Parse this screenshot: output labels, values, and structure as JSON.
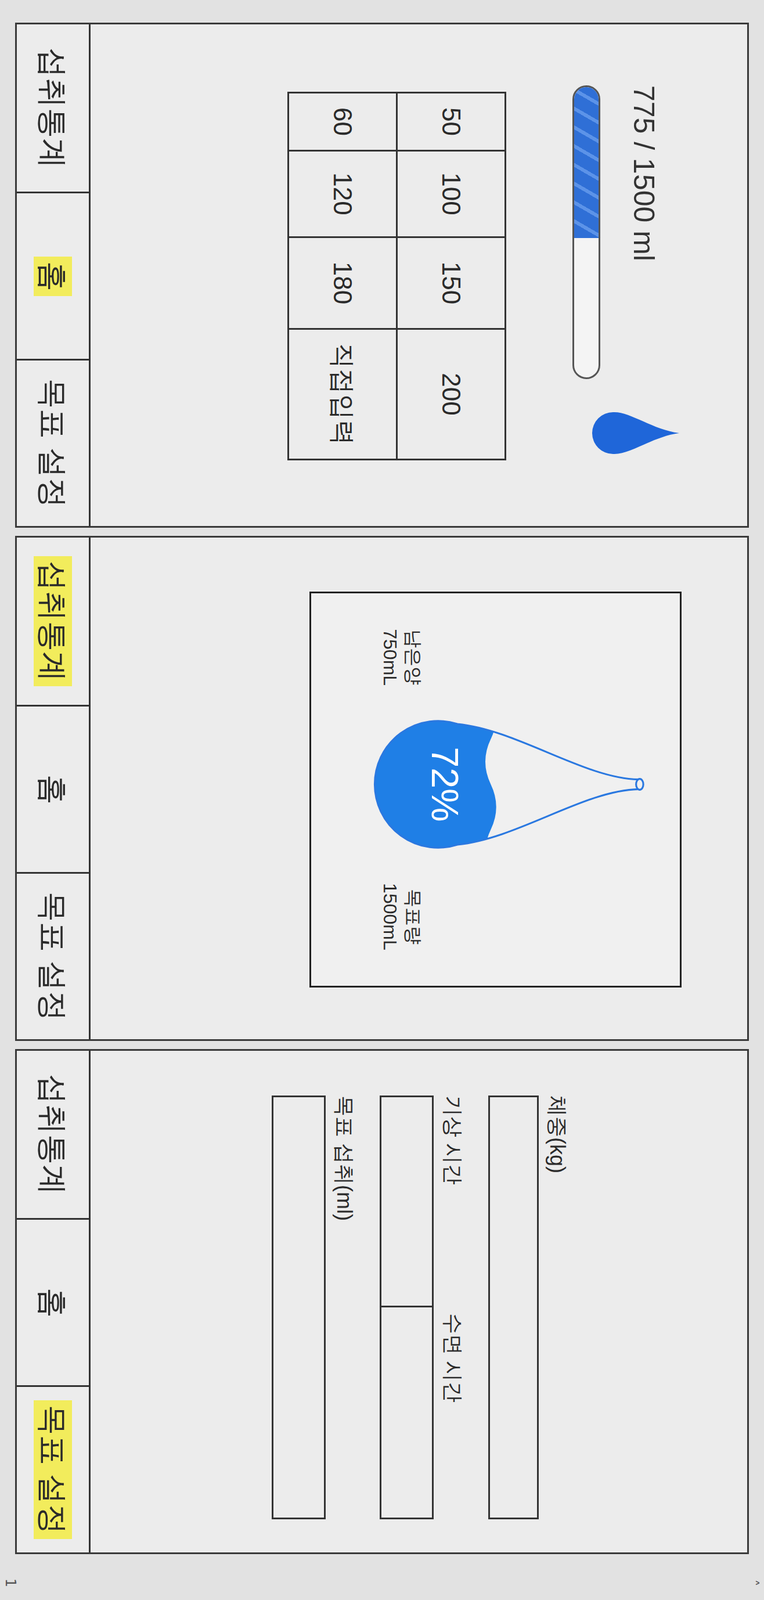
{
  "screens": [
    {
      "kind": "home",
      "tabs": [
        {
          "label": "섭취통계",
          "selected": false
        },
        {
          "label": "홈",
          "selected": true
        },
        {
          "label": "목표 설정",
          "selected": false
        }
      ]
    },
    {
      "kind": "stats",
      "tabs": [
        {
          "label": "섭취통계",
          "selected": true
        },
        {
          "label": "홈",
          "selected": false
        },
        {
          "label": "목표 설정",
          "selected": false
        }
      ]
    },
    {
      "kind": "settings",
      "tabs": [
        {
          "label": "섭취통계",
          "selected": false
        },
        {
          "label": "홈",
          "selected": false
        },
        {
          "label": "목표 설정",
          "selected": true
        }
      ]
    }
  ],
  "home": {
    "intake": "775 / 1500 ml",
    "level": 0.52,
    "amounts": [
      "50",
      "100",
      "150",
      "200",
      "60",
      "120",
      "180",
      "직접입력"
    ]
  },
  "stats": {
    "percent": "72%",
    "level": 0.72,
    "remaining_label": "남은양",
    "remaining": "750mL",
    "goal_label": "목표량",
    "goal": "1500mL"
  },
  "settings": {
    "weight_label": "체중(kg)",
    "wake_label": "기상 시간",
    "sleep_label": "수면 시간",
    "goal_label": "목표 섭취(ml)"
  },
  "viewer": {
    "next": "˄",
    "page": "1"
  }
}
